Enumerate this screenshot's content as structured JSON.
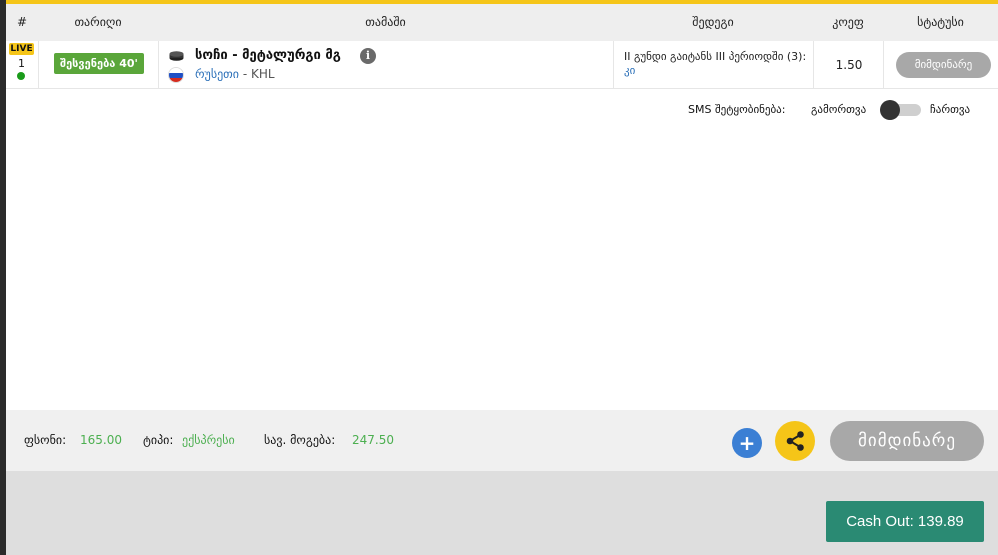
{
  "header": {
    "col_num": "#",
    "col_date": "თარიღი",
    "col_game": "თამაში",
    "col_outcome": "შედეგი",
    "col_odds": "კოეფ",
    "col_status": "სტატუსი"
  },
  "bet": {
    "live_label": "LIVE",
    "row_number": "1",
    "period": "შესვენება 40'",
    "match": "სოჩი - მეტალურგი მგ",
    "info_glyph": "i",
    "country": "რუსეთი",
    "league": " - KHL",
    "outcome_text": "II გუნდი გაიტანს III პერიოდში (3):",
    "outcome_selection": "კი",
    "odds": "1.50",
    "status": "მიმდინარე",
    "sport_icon": "hockey-puck-icon",
    "flag_icon": "russia-flag-icon"
  },
  "sms": {
    "label": "SMS შეტყობინება:",
    "off_label": "გამორთვა",
    "on_label": "ჩართვა",
    "enabled": false
  },
  "summary": {
    "stake_label": "ფსონი:",
    "stake_value": "165.00",
    "type_label": "ტიპი:",
    "type_value": "ექსპრესი",
    "win_label": "სავ. მოგება:",
    "win_value": "247.50",
    "plus_glyph": "+",
    "status_big": "მიმდინარე"
  },
  "footer": {
    "cashout_label": "Cash Out: 139.89"
  },
  "colors": {
    "accent_yellow": "#f5c518",
    "live_green": "#5aa63a",
    "value_green": "#4caf50",
    "cashout_teal": "#2a8a73",
    "link_blue": "#2a6fb8",
    "plus_blue": "#3b7fd4"
  }
}
